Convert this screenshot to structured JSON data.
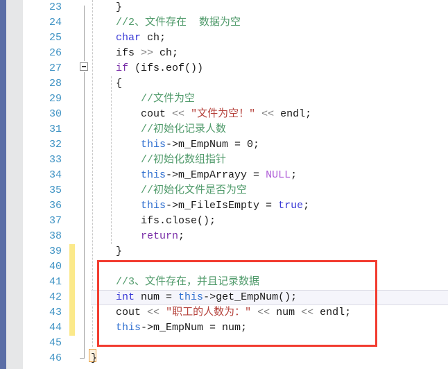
{
  "editor": {
    "app_kind": "code-editor",
    "language": "C++",
    "first_line_number": 23,
    "line_height_px": 22,
    "colors": {
      "background": "#ffffff",
      "left_strip": "#5b6ea6",
      "gutter": "#e6e7e8",
      "line_number": "#3f93c4",
      "change_bar": "#fbe98a",
      "annotation_box": "#f23c30",
      "current_line_bg": "#f5f5fb",
      "comment": "#4f9a6a",
      "keyword": "#3b3bd6",
      "keyword_control": "#7a2fa8",
      "string": "#b5413b",
      "constant": "#b05fd8",
      "operator": "#7d7d7d",
      "identifier": "#1a1a1a",
      "this_keyword": "#2f6fd0",
      "brace_match_border": "#e8a44a",
      "brace_match_bg": "#fdf2e0"
    },
    "current_line": 42,
    "change_bar_lines": [
      39,
      40,
      41,
      42,
      43,
      44
    ],
    "fold_marker_line": 27,
    "brace_match_line": 46,
    "annotation": {
      "type": "red-rectangle",
      "covers_lines": [
        41,
        42,
        43,
        44
      ]
    },
    "lines": [
      {
        "number": 23,
        "tokens": [
          {
            "text": "    ",
            "cls": "t-plain"
          },
          {
            "text": "}",
            "cls": "t-brace"
          }
        ]
      },
      {
        "number": 24,
        "tokens": [
          {
            "text": "    ",
            "cls": "t-plain"
          },
          {
            "text": "//2、文件存在  数据为空",
            "cls": "t-comment"
          }
        ]
      },
      {
        "number": 25,
        "tokens": [
          {
            "text": "    ",
            "cls": "t-plain"
          },
          {
            "text": "char",
            "cls": "t-kw"
          },
          {
            "text": " ch;",
            "cls": "t-plain"
          }
        ]
      },
      {
        "number": 26,
        "tokens": [
          {
            "text": "    ",
            "cls": "t-plain"
          },
          {
            "text": "ifs ",
            "cls": "t-plain"
          },
          {
            "text": ">>",
            "cls": "t-op"
          },
          {
            "text": " ch;",
            "cls": "t-plain"
          }
        ]
      },
      {
        "number": 27,
        "tokens": [
          {
            "text": "    ",
            "cls": "t-plain"
          },
          {
            "text": "if",
            "cls": "t-kw2"
          },
          {
            "text": " (ifs.eof())",
            "cls": "t-plain"
          }
        ]
      },
      {
        "number": 28,
        "tokens": [
          {
            "text": "    ",
            "cls": "t-plain"
          },
          {
            "text": "{",
            "cls": "t-brace"
          }
        ]
      },
      {
        "number": 29,
        "tokens": [
          {
            "text": "        ",
            "cls": "t-plain"
          },
          {
            "text": "//文件为空",
            "cls": "t-comment"
          }
        ]
      },
      {
        "number": 30,
        "tokens": [
          {
            "text": "        ",
            "cls": "t-plain"
          },
          {
            "text": "cout ",
            "cls": "t-plain"
          },
          {
            "text": "<<",
            "cls": "t-op"
          },
          {
            "text": " ",
            "cls": "t-plain"
          },
          {
            "text": "\"文件为空！\"",
            "cls": "t-string"
          },
          {
            "text": " ",
            "cls": "t-plain"
          },
          {
            "text": "<<",
            "cls": "t-op"
          },
          {
            "text": " endl;",
            "cls": "t-plain"
          }
        ]
      },
      {
        "number": 31,
        "tokens": [
          {
            "text": "        ",
            "cls": "t-plain"
          },
          {
            "text": "//初始化记录人数",
            "cls": "t-comment"
          }
        ]
      },
      {
        "number": 32,
        "tokens": [
          {
            "text": "        ",
            "cls": "t-plain"
          },
          {
            "text": "this",
            "cls": "t-this"
          },
          {
            "text": "->m_EmpNum = 0;",
            "cls": "t-plain"
          }
        ]
      },
      {
        "number": 33,
        "tokens": [
          {
            "text": "        ",
            "cls": "t-plain"
          },
          {
            "text": "//初始化数组指针",
            "cls": "t-comment"
          }
        ]
      },
      {
        "number": 34,
        "tokens": [
          {
            "text": "        ",
            "cls": "t-plain"
          },
          {
            "text": "this",
            "cls": "t-this"
          },
          {
            "text": "->m_EmpArrayy = ",
            "cls": "t-plain"
          },
          {
            "text": "NULL",
            "cls": "t-const"
          },
          {
            "text": ";",
            "cls": "t-plain"
          }
        ]
      },
      {
        "number": 35,
        "tokens": [
          {
            "text": "        ",
            "cls": "t-plain"
          },
          {
            "text": "//初始化文件是否为空",
            "cls": "t-comment"
          }
        ]
      },
      {
        "number": 36,
        "tokens": [
          {
            "text": "        ",
            "cls": "t-plain"
          },
          {
            "text": "this",
            "cls": "t-this"
          },
          {
            "text": "->m_FileIsEmpty = ",
            "cls": "t-plain"
          },
          {
            "text": "true",
            "cls": "t-kw"
          },
          {
            "text": ";",
            "cls": "t-plain"
          }
        ]
      },
      {
        "number": 37,
        "tokens": [
          {
            "text": "        ",
            "cls": "t-plain"
          },
          {
            "text": "ifs.close();",
            "cls": "t-plain"
          }
        ]
      },
      {
        "number": 38,
        "tokens": [
          {
            "text": "        ",
            "cls": "t-plain"
          },
          {
            "text": "return",
            "cls": "t-kw2"
          },
          {
            "text": ";",
            "cls": "t-plain"
          }
        ]
      },
      {
        "number": 39,
        "tokens": [
          {
            "text": "    ",
            "cls": "t-plain"
          },
          {
            "text": "}",
            "cls": "t-brace"
          }
        ]
      },
      {
        "number": 40,
        "tokens": [
          {
            "text": "",
            "cls": "t-plain"
          }
        ]
      },
      {
        "number": 41,
        "tokens": [
          {
            "text": "    ",
            "cls": "t-plain"
          },
          {
            "text": "//3、文件存在，并且记录数据",
            "cls": "t-comment"
          }
        ]
      },
      {
        "number": 42,
        "tokens": [
          {
            "text": "    ",
            "cls": "t-plain"
          },
          {
            "text": "int",
            "cls": "t-kw"
          },
          {
            "text": " num = ",
            "cls": "t-plain"
          },
          {
            "text": "this",
            "cls": "t-this"
          },
          {
            "text": "->get_EmpNum();",
            "cls": "t-plain"
          }
        ]
      },
      {
        "number": 43,
        "tokens": [
          {
            "text": "    ",
            "cls": "t-plain"
          },
          {
            "text": "cout ",
            "cls": "t-plain"
          },
          {
            "text": "<<",
            "cls": "t-op"
          },
          {
            "text": " ",
            "cls": "t-plain"
          },
          {
            "text": "\"职工的人数为：\"",
            "cls": "t-string"
          },
          {
            "text": " ",
            "cls": "t-plain"
          },
          {
            "text": "<<",
            "cls": "t-op"
          },
          {
            "text": " num ",
            "cls": "t-plain"
          },
          {
            "text": "<<",
            "cls": "t-op"
          },
          {
            "text": " endl;",
            "cls": "t-plain"
          }
        ]
      },
      {
        "number": 44,
        "tokens": [
          {
            "text": "    ",
            "cls": "t-plain"
          },
          {
            "text": "this",
            "cls": "t-this"
          },
          {
            "text": "->m_EmpNum = num;",
            "cls": "t-plain"
          }
        ]
      },
      {
        "number": 45,
        "tokens": [
          {
            "text": "",
            "cls": "t-plain"
          }
        ]
      },
      {
        "number": 46,
        "tokens": [
          {
            "text": "",
            "cls": "t-plain"
          },
          {
            "text": "}",
            "cls": "t-brace"
          }
        ]
      }
    ]
  }
}
